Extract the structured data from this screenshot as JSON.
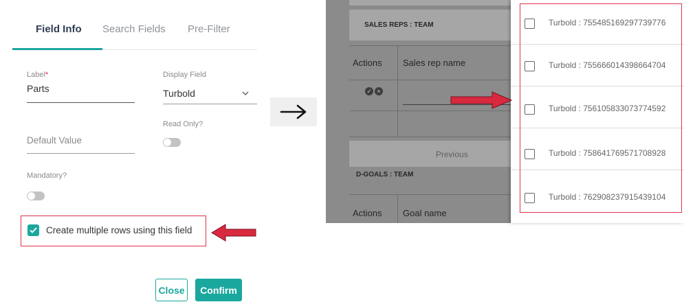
{
  "dialog": {
    "tabs": [
      {
        "label": "Field Info",
        "active": true
      },
      {
        "label": "Search Fields",
        "active": false
      },
      {
        "label": "Pre-Filter",
        "active": false
      }
    ],
    "label_field": {
      "label": "Label",
      "required_mark": "*",
      "value": "Parts"
    },
    "display_field": {
      "label": "Display Field",
      "value": "Turbold"
    },
    "default_value": {
      "placeholder": "Default Value"
    },
    "read_only": {
      "label": "Read Only?",
      "on": false
    },
    "mandatory": {
      "label": "Mandatory?",
      "on": false
    },
    "multi_rows": {
      "label": "Create multiple rows using this field",
      "checked": true
    },
    "buttons": {
      "close": "Close",
      "confirm": "Confirm"
    }
  },
  "background_table": {
    "section1_title": "SALES REPS : TEAM",
    "col_actions": "Actions",
    "col_name": "Sales rep name",
    "previous_label": "Previous",
    "section2_title": "D-GOALS : TEAM",
    "col_actions_2": "Actions",
    "col_name_2": "Goal name"
  },
  "dropdown": {
    "items": [
      {
        "label": "Turbold : 755485169297739776",
        "checked": false
      },
      {
        "label": "Turbold : 755666014398664704",
        "checked": false
      },
      {
        "label": "Turbold : 756105833073774592",
        "checked": false
      },
      {
        "label": "Turbold : 758641769571708928",
        "checked": false
      },
      {
        "label": "Turbold : 762908237915439104",
        "checked": false
      }
    ]
  },
  "colors": {
    "accent": "#1aa79e",
    "highlight": "#e03148",
    "arrow": "#d9293f"
  },
  "icons": [
    "check-icon",
    "chevron-down-icon",
    "red-arrow-icon",
    "black-arrow-icon",
    "check-circle-icon",
    "x-circle-icon"
  ]
}
